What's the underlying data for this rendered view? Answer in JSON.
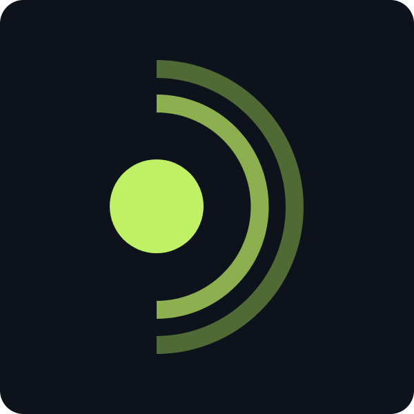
{
  "icon": {
    "name": "signal-broadcast-app-icon",
    "symbol": "signal-waves-icon",
    "colors": {
      "background": "#0e131b",
      "dot": "#c0f066",
      "inner_arc": "#8cb050",
      "outer_arc": "#4f6a35"
    }
  }
}
